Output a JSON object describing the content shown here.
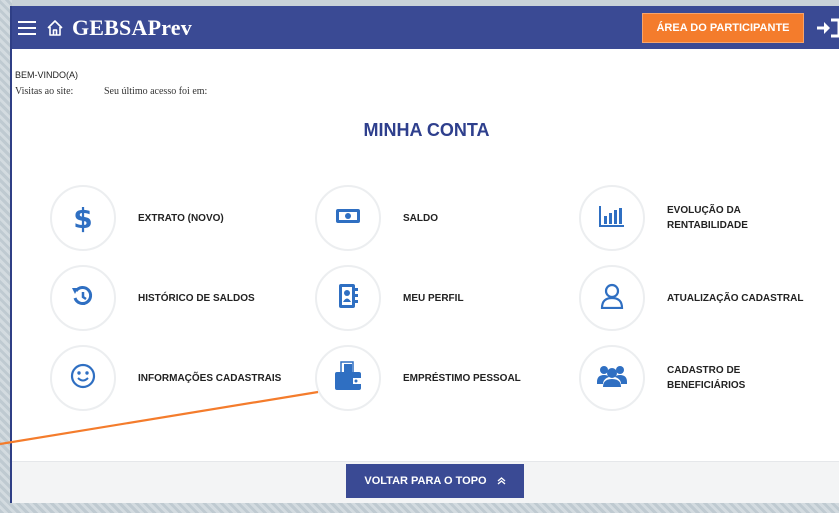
{
  "header": {
    "brand": "GEBSAPrev",
    "participant_area_label": "ÁREA DO PARTICIPANTE",
    "menu_icon": "hamburger-menu-icon",
    "home_icon": "home-icon",
    "logout_icon": "logout-icon"
  },
  "user": {
    "welcome": "BEM-VINDO(A)",
    "visits_label": "Visitas ao site:",
    "last_access_label": "Seu último acesso foi em:"
  },
  "main": {
    "title": "MINHA CONTA",
    "tiles": [
      {
        "label": "EXTRATO (NOVO)",
        "icon": "dollar-icon"
      },
      {
        "label": "SALDO",
        "icon": "banknote-icon"
      },
      {
        "label": "EVOLUÇÃO DA RENTABILIDADE",
        "icon": "bar-chart-icon"
      },
      {
        "label": "HISTÓRICO DE SALDOS",
        "icon": "history-icon"
      },
      {
        "label": "MEU PERFIL",
        "icon": "profile-card-icon"
      },
      {
        "label": "ATUALIZAÇÃO CADASTRAL",
        "icon": "user-outline-icon"
      },
      {
        "label": "INFORMAÇÕES CADASTRAIS",
        "icon": "smiley-icon"
      },
      {
        "label": "EMPRÉSTIMO PESSOAL",
        "icon": "wallet-icon"
      },
      {
        "label": "CADASTRO DE BENEFICIÁRIOS",
        "icon": "group-icon"
      }
    ]
  },
  "footer": {
    "back_to_top_label": "VOLTAR PARA O TOPO",
    "chevron_icon": "chevron-up-icon"
  },
  "colors": {
    "navbar": "#3a4a94",
    "accent_orange": "#f47c2c",
    "icon_blue": "#2f6fc2",
    "title_blue": "#2e3f8d"
  }
}
